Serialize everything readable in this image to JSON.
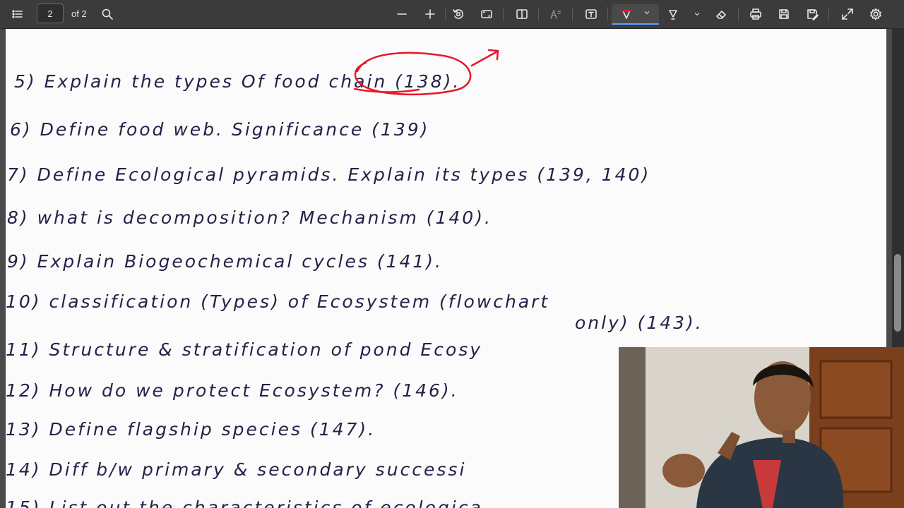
{
  "toolbar": {
    "page_current": "2",
    "page_total_label": "of 2",
    "icons": [
      "contents-icon",
      "search-icon",
      "zoom-out-icon",
      "zoom-in-icon",
      "rotate-icon",
      "fit-page-icon",
      "page-view-icon",
      "read-aloud-icon",
      "text-box-icon",
      "draw-icon",
      "highlight-icon",
      "eraser-icon",
      "print-icon",
      "save-icon",
      "save-as-icon",
      "fullscreen-icon",
      "settings-icon"
    ],
    "draw_color": "#e8152b",
    "active_tool": "draw"
  },
  "document": {
    "lines": [
      "5) Explain the types Of food chain (138).",
      "6) Define food web. Significance (139)",
      "7) Define Ecological pyramids. Explain its types (139, 140)",
      "8) what is decomposition? Mechanism (140).",
      "9) Explain Biogeochemical cycles (141).",
      "10) classification (Types) of Ecosystem (flowchart",
      "only) (143).",
      "11) Structure & stratification of pond Ecosy",
      "12) How do we protect Ecosystem? (146).",
      "13) Define flagship species (147).",
      "14) Diff b/w primary & secondary successi",
      "15) List out the characteristics of ecologica"
    ]
  },
  "webcam": {
    "description_icon": "presenter-video-icon"
  }
}
